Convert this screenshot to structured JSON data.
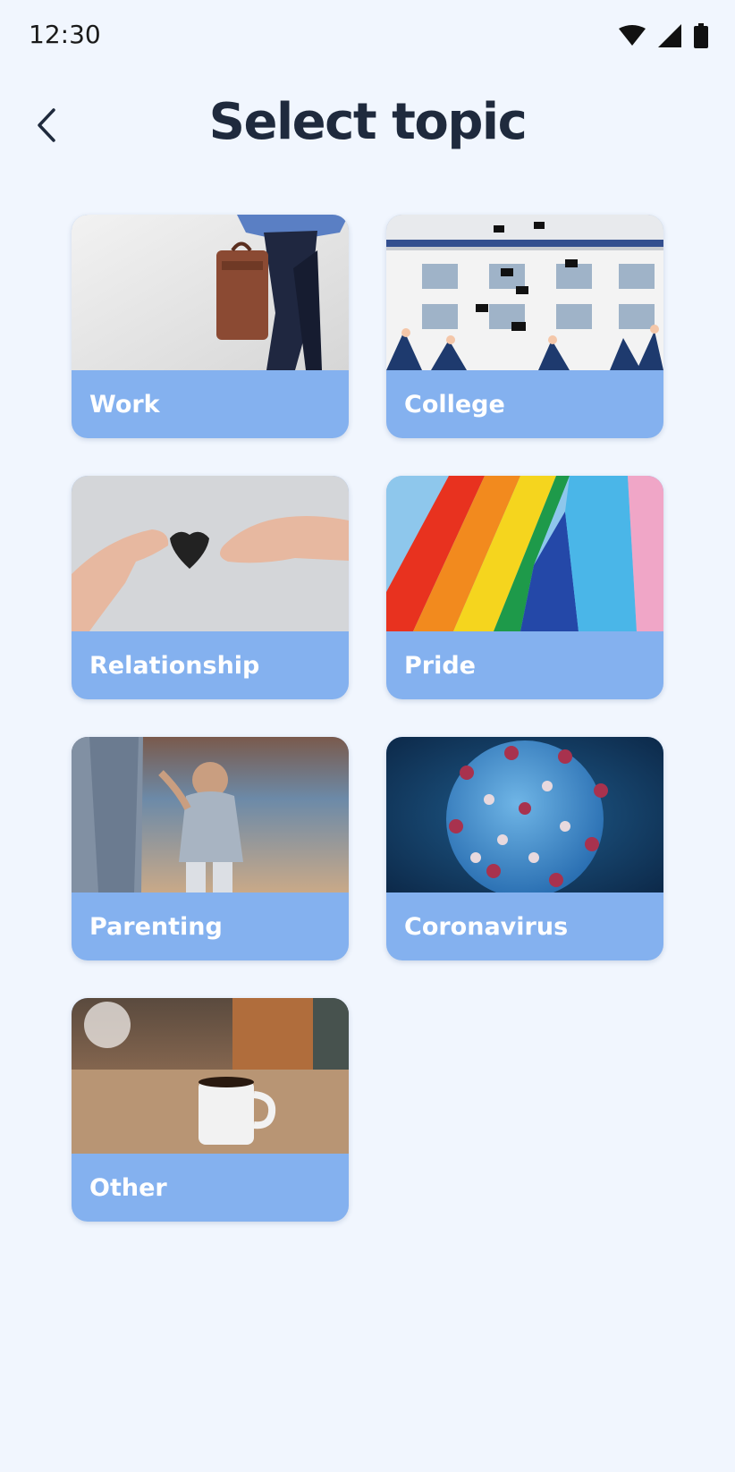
{
  "status_bar": {
    "time": "12:30",
    "icons": [
      "wifi-icon",
      "cell-signal-icon",
      "battery-icon"
    ]
  },
  "header": {
    "back_icon": "chevron-left-icon",
    "title": "Select topic"
  },
  "topics": [
    {
      "label": "Work",
      "image": "briefcase-photo"
    },
    {
      "label": "College",
      "image": "graduation-caps-photo"
    },
    {
      "label": "Relationship",
      "image": "paper-heart-hands-photo"
    },
    {
      "label": "Pride",
      "image": "rainbow-flag-photo"
    },
    {
      "label": "Parenting",
      "image": "child-walking-photo"
    },
    {
      "label": "Coronavirus",
      "image": "virus-photo"
    },
    {
      "label": "Other",
      "image": "coffee-mug-photo"
    }
  ],
  "colors": {
    "background": "#f1f6fe",
    "card_label_bg": "#84b1ef",
    "title_text": "#1f2a3d",
    "label_text": "#ffffff"
  }
}
